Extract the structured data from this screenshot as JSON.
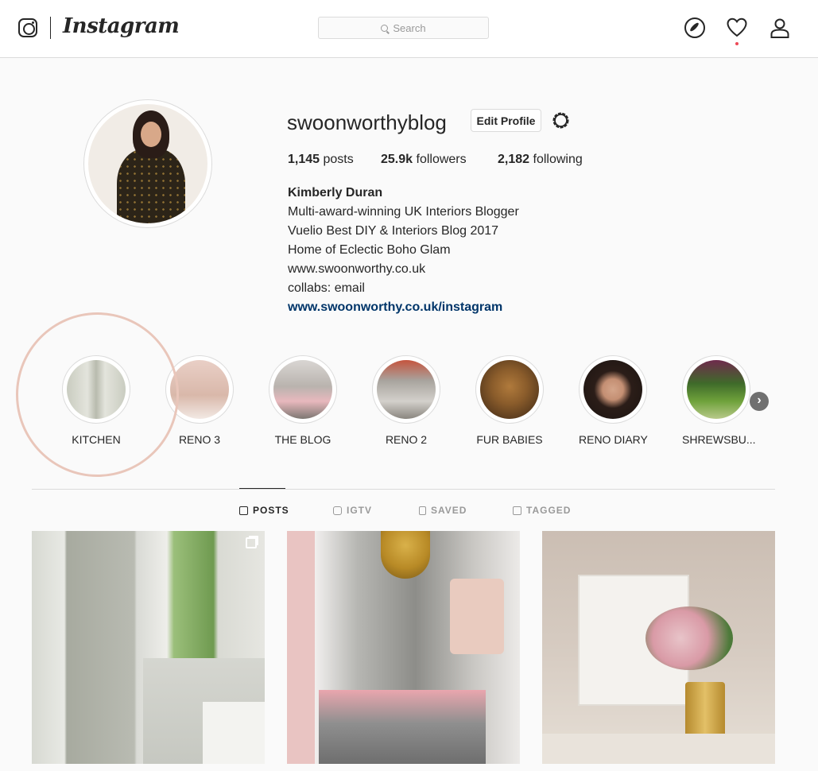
{
  "nav": {
    "brand": "Instagram",
    "search_placeholder": "Search"
  },
  "profile": {
    "username": "swoonworthyblog",
    "edit_label": "Edit Profile",
    "stats": [
      {
        "count": "1,145",
        "label": "posts"
      },
      {
        "count": "25.9k",
        "label": "followers"
      },
      {
        "count": "2,182",
        "label": "following"
      }
    ],
    "bio": {
      "name": "Kimberly Duran",
      "lines": [
        "Multi-award-winning UK Interiors Blogger",
        "Vuelio Best DIY & Interiors Blog 2017",
        "Home of Eclectic Boho Glam",
        "www.swoonworthy.co.uk",
        "collabs: email"
      ],
      "link": "www.swoonworthy.co.uk/instagram"
    }
  },
  "highlights": [
    {
      "label": "KITCHEN"
    },
    {
      "label": "RENO 3"
    },
    {
      "label": "THE BLOG"
    },
    {
      "label": "RENO 2"
    },
    {
      "label": "FUR BABIES"
    },
    {
      "label": "RENO DIARY"
    },
    {
      "label": "SHREWSBU..."
    }
  ],
  "tabs": [
    {
      "label": "POSTS",
      "icon": "grid-icon"
    },
    {
      "label": "IGTV",
      "icon": "tv-icon"
    },
    {
      "label": "SAVED",
      "icon": "bookmark-icon"
    },
    {
      "label": "TAGGED",
      "icon": "tag-icon"
    }
  ],
  "colors": {
    "link": "#003569",
    "annotation": "#e9c6ba",
    "notification": "#ed4956"
  }
}
